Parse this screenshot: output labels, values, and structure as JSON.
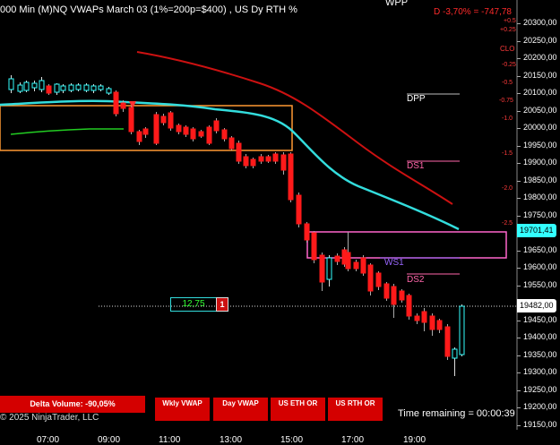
{
  "header": {
    "title": "000 Min (M)NQ VWAPs March 03 (1%=200p=$400) , US Dy RTH %",
    "wpp": "WPP",
    "daily_change": "D -3,70% = -747,78"
  },
  "price_axis": {
    "labels": [
      "20300,00",
      "20250,00",
      "20200,00",
      "20150,00",
      "20100,00",
      "20050,00",
      "20000,00",
      "19950,00",
      "19900,00",
      "19850,00",
      "19800,00",
      "19750,00",
      "19650,00",
      "19600,00",
      "19550,00",
      "19450,00",
      "19400,00",
      "19350,00",
      "19300,00",
      "19250,00",
      "19200,00",
      "19150,00"
    ],
    "current_vwap_tag": "19701,41",
    "current_price_tag": "19482,00",
    "percent_labels": [
      "+0.5",
      "+0.25",
      "CLO",
      "-0.25",
      "-0.5",
      "-0.75",
      "-1.0",
      "-1.5",
      "-2.0",
      "-2.5"
    ]
  },
  "levels": {
    "dpp": "DPP",
    "ds1": "DS1",
    "ws1": "WS1",
    "ds2": "DS2"
  },
  "time_axis": [
    "07:00",
    "09:00",
    "11:00",
    "13:00",
    "15:00",
    "17:00",
    "19:00"
  ],
  "volume_indicator": {
    "value": "12,75",
    "count": "1"
  },
  "bottom_bar": {
    "delta_volume": "Delta Volume: -90,05%",
    "buttons": [
      "Wkly VWAP",
      "Day VWAP",
      "US ETH OR",
      "US RTH OR"
    ],
    "copyright": "© 2025 NinjaTrader, LLC",
    "time_remaining": "Time remaining = 00:00:39"
  },
  "colors": {
    "background": "#000000",
    "up_candle": "#33ffff",
    "down_candle": "#ff1a1a",
    "red_vwap": "#cc1111",
    "cyan_vwap": "#33dddd",
    "green_line": "#22cc22",
    "or_box": "#ff9933",
    "pink_box": "#ff66cc"
  }
}
